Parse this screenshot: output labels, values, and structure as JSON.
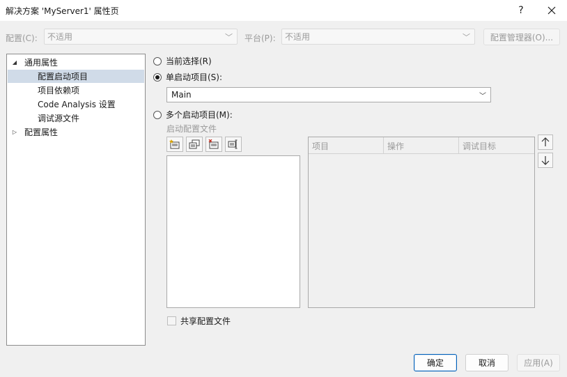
{
  "window": {
    "title": "解决方案 'MyServer1' 属性页",
    "help_label": "?",
    "close_label": "✕"
  },
  "config_row": {
    "config_label": "配置(C):",
    "config_value": "不适用",
    "platform_label": "平台(P):",
    "platform_value": "不适用",
    "manager_button": "配置管理器(O)..."
  },
  "tree": {
    "items": [
      {
        "label": "通用属性",
        "expander": "◢",
        "level": 0,
        "selected": false
      },
      {
        "label": "配置启动项目",
        "expander": "",
        "level": 1,
        "selected": true
      },
      {
        "label": "项目依赖项",
        "expander": "",
        "level": 1,
        "selected": false
      },
      {
        "label": "Code Analysis 设置",
        "expander": "",
        "level": 1,
        "selected": false
      },
      {
        "label": "调试源文件",
        "expander": "",
        "level": 1,
        "selected": false
      },
      {
        "label": "配置属性",
        "expander": "▷",
        "level": 0,
        "selected": false
      }
    ]
  },
  "startup": {
    "current_selection_label": "当前选择(R)",
    "single_startup_label": "单启动项目(S):",
    "single_startup_value": "Main",
    "multiple_startup_label": "多个启动项目(M):",
    "launch_profiles_label": "启动配置文件",
    "selected_option": "single"
  },
  "grid": {
    "columns": [
      "项目",
      "操作",
      "调试目标"
    ]
  },
  "share_profile_label": "共享配置文件",
  "footer": {
    "ok_label": "确定",
    "cancel_label": "取消",
    "apply_label": "应用(A)"
  },
  "colors": {
    "accent": "#005fb8",
    "tree_selection": "#d0dbe8"
  }
}
